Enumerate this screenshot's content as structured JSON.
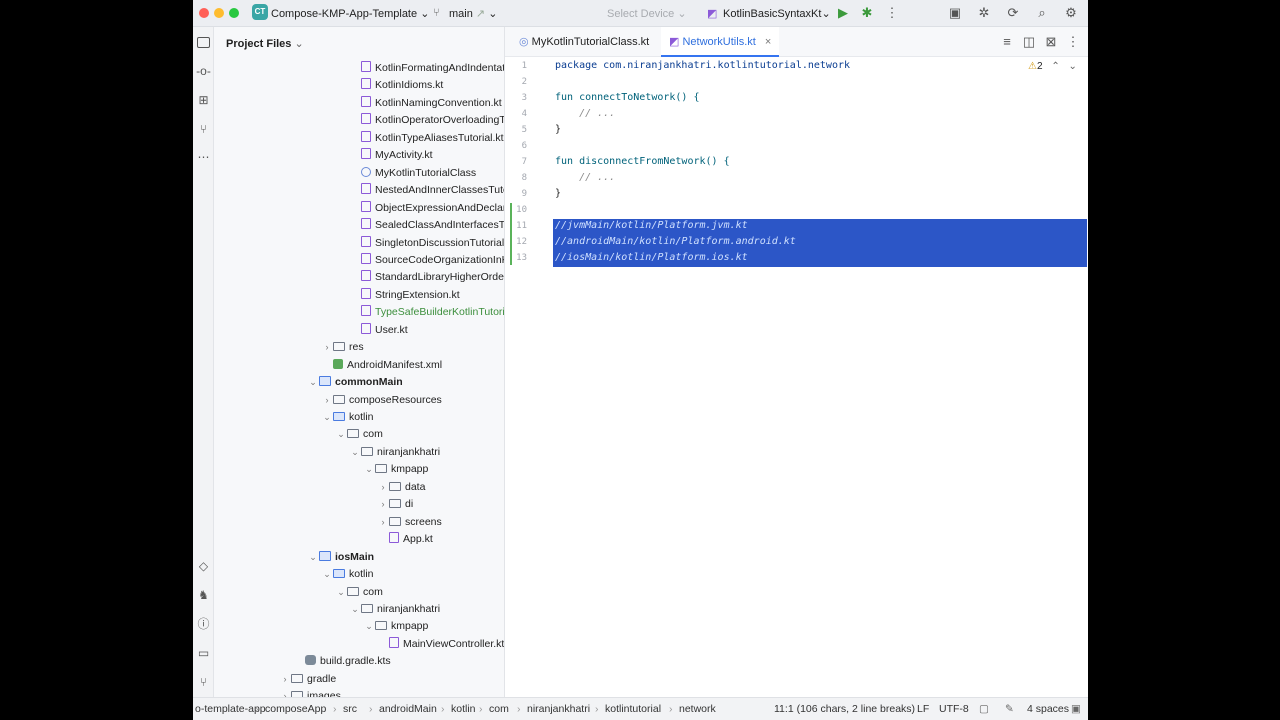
{
  "titlebar": {
    "project_badge": "CT",
    "project_name": "Compose-KMP-App-Template",
    "branch": "main",
    "device": "Select Device",
    "run_config": "KotlinBasicSyntaxKt"
  },
  "project_panel": {
    "title": "Project Files",
    "tree": [
      {
        "label": "KotlinFormatingAndIndentation",
        "icon": "kt",
        "indent": 3,
        "chev": ""
      },
      {
        "label": "KotlinIdioms.kt",
        "icon": "kt",
        "indent": 3,
        "chev": ""
      },
      {
        "label": "KotlinNamingConvention.kt",
        "icon": "kt",
        "indent": 3,
        "chev": ""
      },
      {
        "label": "KotlinOperatorOverloadingTuto",
        "icon": "kt",
        "indent": 3,
        "chev": ""
      },
      {
        "label": "KotlinTypeAliasesTutorial.kt",
        "icon": "kt",
        "indent": 3,
        "chev": ""
      },
      {
        "label": "MyActivity.kt",
        "icon": "kt",
        "indent": 3,
        "chev": ""
      },
      {
        "label": "MyKotlinTutorialClass",
        "icon": "cls",
        "indent": 3,
        "chev": ""
      },
      {
        "label": "NestedAndInnerClassesTutoria",
        "icon": "kt",
        "indent": 3,
        "chev": ""
      },
      {
        "label": "ObjectExpressionAndDeclarati",
        "icon": "kt",
        "indent": 3,
        "chev": ""
      },
      {
        "label": "SealedClassAndInterfacesTuto",
        "icon": "kt",
        "indent": 3,
        "chev": ""
      },
      {
        "label": "SingletonDiscussionTutorial.kt",
        "icon": "kt",
        "indent": 3,
        "chev": ""
      },
      {
        "label": "SourceCodeOrganizationInKotl",
        "icon": "kt",
        "indent": 3,
        "chev": ""
      },
      {
        "label": "StandardLibraryHigherOrderFu",
        "icon": "kt",
        "indent": 3,
        "chev": ""
      },
      {
        "label": "StringExtension.kt",
        "icon": "kt",
        "indent": 3,
        "chev": ""
      },
      {
        "label": "TypeSafeBuilderKotlinTutorial.",
        "icon": "kt",
        "indent": 3,
        "chev": "",
        "style": "green"
      },
      {
        "label": "User.kt",
        "icon": "kt",
        "indent": 3,
        "chev": ""
      },
      {
        "label": "res",
        "icon": "folder",
        "indent": 1,
        "chev": "›"
      },
      {
        "label": "AndroidManifest.xml",
        "icon": "xml",
        "indent": 1,
        "chev": ""
      },
      {
        "label": "commonMain",
        "icon": "module",
        "indent": 0,
        "chev": "⌄",
        "style": "bold"
      },
      {
        "label": "composeResources",
        "icon": "folder",
        "indent": 1,
        "chev": "›"
      },
      {
        "label": "kotlin",
        "icon": "folder-blue",
        "indent": 1,
        "chev": "⌄"
      },
      {
        "label": "com",
        "icon": "folder",
        "indent": 2,
        "chev": "⌄"
      },
      {
        "label": "niranjankhatri",
        "icon": "folder",
        "indent": 3,
        "chev": "⌄"
      },
      {
        "label": "kmpapp",
        "icon": "folder",
        "indent": 4,
        "chev": "⌄"
      },
      {
        "label": "data",
        "icon": "folder",
        "indent": 5,
        "chev": "›"
      },
      {
        "label": "di",
        "icon": "folder",
        "indent": 5,
        "chev": "›"
      },
      {
        "label": "screens",
        "icon": "folder",
        "indent": 5,
        "chev": "›"
      },
      {
        "label": "App.kt",
        "icon": "kt",
        "indent": 5,
        "chev": ""
      },
      {
        "label": "iosMain",
        "icon": "module",
        "indent": 0,
        "chev": "⌄",
        "style": "bold"
      },
      {
        "label": "kotlin",
        "icon": "folder-blue",
        "indent": 1,
        "chev": "⌄"
      },
      {
        "label": "com",
        "icon": "folder",
        "indent": 2,
        "chev": "⌄"
      },
      {
        "label": "niranjankhatri",
        "icon": "folder",
        "indent": 3,
        "chev": "⌄"
      },
      {
        "label": "kmpapp",
        "icon": "folder",
        "indent": 4,
        "chev": "⌄"
      },
      {
        "label": "MainViewController.kt",
        "icon": "kt",
        "indent": 5,
        "chev": ""
      },
      {
        "label": "build.gradle.kts",
        "icon": "gradle",
        "indent": -1,
        "chev": ""
      },
      {
        "label": "gradle",
        "icon": "folder",
        "indent": -2,
        "chev": "›"
      },
      {
        "label": "images",
        "icon": "folder",
        "indent": -2,
        "chev": "›"
      }
    ]
  },
  "editor": {
    "tabs": [
      {
        "label": "MyKotlinTutorialClass.kt",
        "active": false
      },
      {
        "label": "NetworkUtils.kt",
        "active": true
      }
    ],
    "warnings": "2",
    "lines": [
      {
        "n": "1",
        "text": "package com.niranjankhatri.kotlintutorial.network",
        "kind": "package"
      },
      {
        "n": "2",
        "text": "",
        "kind": "plain"
      },
      {
        "n": "3",
        "text": "fun connectToNetwork() {",
        "kind": "fun"
      },
      {
        "n": "4",
        "text": "    // ...",
        "kind": "comment"
      },
      {
        "n": "5",
        "text": "}",
        "kind": "plain"
      },
      {
        "n": "6",
        "text": "",
        "kind": "plain"
      },
      {
        "n": "7",
        "text": "fun disconnectFromNetwork() {",
        "kind": "fun"
      },
      {
        "n": "8",
        "text": "    // ...",
        "kind": "comment"
      },
      {
        "n": "9",
        "text": "}",
        "kind": "plain"
      },
      {
        "n": "10",
        "text": "",
        "kind": "plain"
      },
      {
        "n": "11",
        "text": "//jvmMain/kotlin/Platform.jvm.kt",
        "kind": "selected"
      },
      {
        "n": "12",
        "text": "//androidMain/kotlin/Platform.android.kt",
        "kind": "selected"
      },
      {
        "n": "13",
        "text": "//iosMain/kotlin/Platform.ios.kt",
        "kind": "selected"
      }
    ]
  },
  "statusbar": {
    "breadcrumbs": [
      "o-template-app",
      "composeApp",
      "src",
      "androidMain",
      "kotlin",
      "com",
      "niranjankhatri",
      "kotlintutorial",
      "network"
    ],
    "position": "11:1 (106 chars, 2 line breaks)",
    "line_sep": "LF",
    "encoding": "UTF-8",
    "indent": "4 spaces"
  }
}
